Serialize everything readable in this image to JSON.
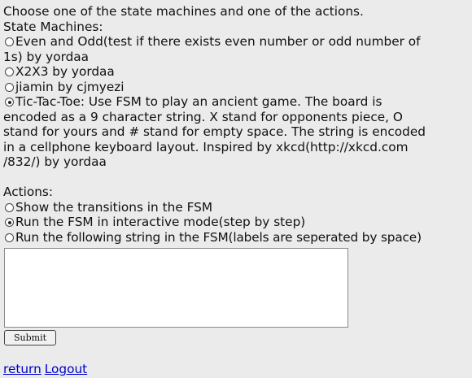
{
  "instructions": "Choose one of the state machines and one of the actions.",
  "state_machines": {
    "heading": "State Machines:",
    "options": [
      {
        "lines": [
          "Even and Odd(test if there exists even number or odd number of",
          "1s) by yordaa"
        ],
        "checked": false
      },
      {
        "lines": [
          "X2X3 by yordaa"
        ],
        "checked": false
      },
      {
        "lines": [
          "jiamin by cjmyezi"
        ],
        "checked": false
      },
      {
        "lines": [
          "Tic-Tac-Toe: Use FSM to play an ancient game. The board is",
          "encoded as a 9 character string. X stand for opponents piece, O",
          "stand for yours and # stand for empty space. The string is encoded",
          "in a cellphone keyboard layout. Inspired by xkcd(http://xkcd.com",
          "/832/) by yordaa"
        ],
        "checked": true
      }
    ]
  },
  "actions": {
    "heading": "Actions:",
    "options": [
      {
        "label": "Show the transitions in the FSM",
        "checked": false
      },
      {
        "label": "Run the FSM in interactive mode(step by step)",
        "checked": true
      },
      {
        "label": "Run the following string in the FSM(labels are seperated by space)",
        "checked": false
      }
    ]
  },
  "input_string": {
    "value": ""
  },
  "submit_label": "Submit",
  "links": {
    "return_label": "return",
    "logout_label": "Logout"
  }
}
